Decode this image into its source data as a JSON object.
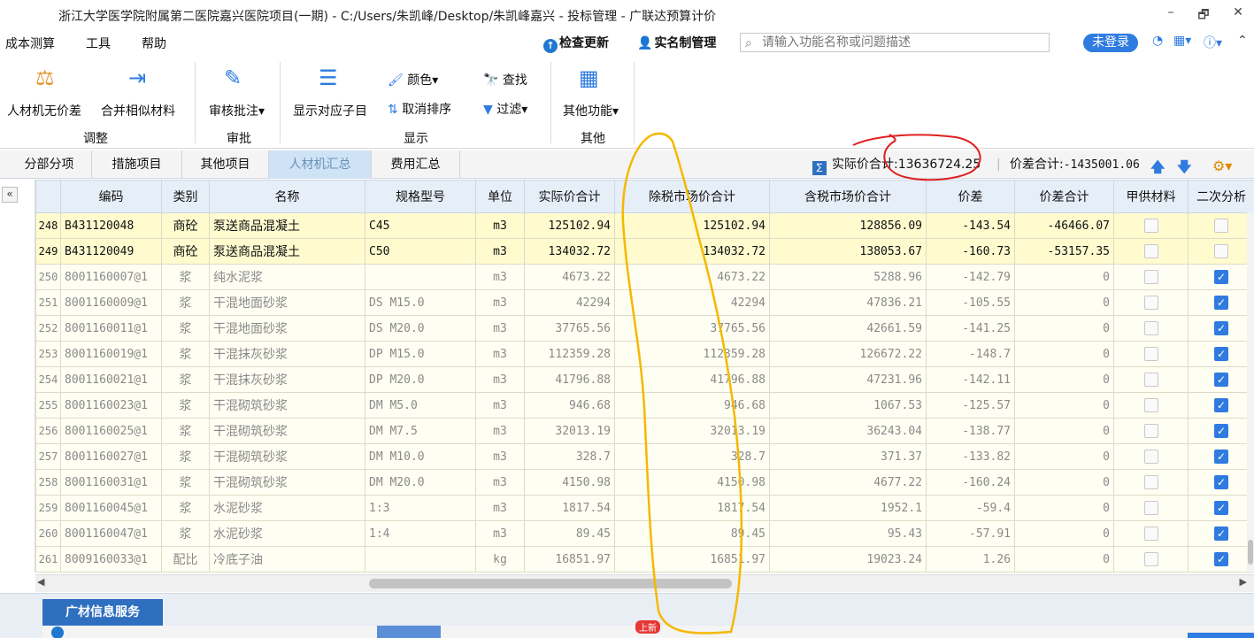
{
  "window": {
    "title": "浙江大学医学院附属第二医院嘉兴医院项目(一期) - C:/Users/朱凯峰/Desktop/朱凯峰嘉兴 - 投标管理 - 广联达预算计价",
    "min": "–",
    "max": "🗗",
    "close": "✕"
  },
  "menu": {
    "items": [
      "成本测算",
      "工具",
      "帮助"
    ],
    "check_update": "检查更新",
    "realname": "实名制管理",
    "search_placeholder": "请输入功能名称或问题描述",
    "login": "未登录"
  },
  "ribbon": {
    "btn_no_diff": "人材机无价差",
    "btn_merge": "合并相似材料",
    "btn_audit": "审核批注",
    "btn_show_sub": "显示对应子目",
    "btn_color": "颜色",
    "btn_cancel_sort": "取消排序",
    "btn_find": "查找",
    "btn_filter": "过滤",
    "btn_other": "其他功能",
    "grp_adjust": "调整",
    "grp_approve": "审批",
    "grp_display": "显示",
    "grp_other": "其他"
  },
  "tabs": [
    "分部分项",
    "措施项目",
    "其他项目",
    "人材机汇总",
    "费用汇总"
  ],
  "summary": {
    "actual_label": "实际价合计:",
    "actual_value": "13636724.25",
    "diff_label": "价差合计:",
    "diff_value": "-1435001.06"
  },
  "grid": {
    "headers": [
      "编码",
      "类别",
      "名称",
      "规格型号",
      "单位",
      "实际价合计",
      "除税市场价合计",
      "含税市场价合计",
      "价差",
      "价差合计",
      "甲供材料",
      "二次分析"
    ],
    "rows": [
      {
        "no": "248",
        "code": "B431120048",
        "type": "商砼",
        "name": "泵送商品混凝土",
        "spec": "C45",
        "unit": "m3",
        "actual": "125102.94",
        "ex_tax": "125102.94",
        "inc_tax": "128856.09",
        "diff": "-143.54",
        "diff_total": "-46466.07",
        "supplied": false,
        "secondary": false,
        "style": "hl"
      },
      {
        "no": "249",
        "code": "B431120049",
        "type": "商砼",
        "name": "泵送商品混凝土",
        "spec": "C50",
        "unit": "m3",
        "actual": "134032.72",
        "ex_tax": "134032.72",
        "inc_tax": "138053.67",
        "diff": "-160.73",
        "diff_total": "-53157.35",
        "supplied": false,
        "secondary": false,
        "style": "hl"
      },
      {
        "no": "250",
        "code": "8001160007@1",
        "type": "浆",
        "name": "纯水泥浆",
        "spec": "",
        "unit": "m3",
        "actual": "4673.22",
        "ex_tax": "4673.22",
        "inc_tax": "5288.96",
        "diff": "-142.79",
        "diff_total": "0",
        "supplied": false,
        "secondary": true,
        "style": "nm"
      },
      {
        "no": "251",
        "code": "8001160009@1",
        "type": "浆",
        "name": "干混地面砂浆",
        "spec": "DS M15.0",
        "unit": "m3",
        "actual": "42294",
        "ex_tax": "42294",
        "inc_tax": "47836.21",
        "diff": "-105.55",
        "diff_total": "0",
        "supplied": false,
        "secondary": true,
        "style": "nm"
      },
      {
        "no": "252",
        "code": "8001160011@1",
        "type": "浆",
        "name": "干混地面砂浆",
        "spec": "DS M20.0",
        "unit": "m3",
        "actual": "37765.56",
        "ex_tax": "37765.56",
        "inc_tax": "42661.59",
        "diff": "-141.25",
        "diff_total": "0",
        "supplied": false,
        "secondary": true,
        "style": "nm"
      },
      {
        "no": "253",
        "code": "8001160019@1",
        "type": "浆",
        "name": "干混抹灰砂浆",
        "spec": "DP M15.0",
        "unit": "m3",
        "actual": "112359.28",
        "ex_tax": "112359.28",
        "inc_tax": "126672.22",
        "diff": "-148.7",
        "diff_total": "0",
        "supplied": false,
        "secondary": true,
        "style": "nm"
      },
      {
        "no": "254",
        "code": "8001160021@1",
        "type": "浆",
        "name": "干混抹灰砂浆",
        "spec": "DP M20.0",
        "unit": "m3",
        "actual": "41796.88",
        "ex_tax": "41796.88",
        "inc_tax": "47231.96",
        "diff": "-142.11",
        "diff_total": "0",
        "supplied": false,
        "secondary": true,
        "style": "nm"
      },
      {
        "no": "255",
        "code": "8001160023@1",
        "type": "浆",
        "name": "干混砌筑砂浆",
        "spec": "DM M5.0",
        "unit": "m3",
        "actual": "946.68",
        "ex_tax": "946.68",
        "inc_tax": "1067.53",
        "diff": "-125.57",
        "diff_total": "0",
        "supplied": false,
        "secondary": true,
        "style": "nm"
      },
      {
        "no": "256",
        "code": "8001160025@1",
        "type": "浆",
        "name": "干混砌筑砂浆",
        "spec": "DM M7.5",
        "unit": "m3",
        "actual": "32013.19",
        "ex_tax": "32013.19",
        "inc_tax": "36243.04",
        "diff": "-138.77",
        "diff_total": "0",
        "supplied": false,
        "secondary": true,
        "style": "nm"
      },
      {
        "no": "257",
        "code": "8001160027@1",
        "type": "浆",
        "name": "干混砌筑砂浆",
        "spec": "DM M10.0",
        "unit": "m3",
        "actual": "328.7",
        "ex_tax": "328.7",
        "inc_tax": "371.37",
        "diff": "-133.82",
        "diff_total": "0",
        "supplied": false,
        "secondary": true,
        "style": "nm"
      },
      {
        "no": "258",
        "code": "8001160031@1",
        "type": "浆",
        "name": "干混砌筑砂浆",
        "spec": "DM M20.0",
        "unit": "m3",
        "actual": "4150.98",
        "ex_tax": "4150.98",
        "inc_tax": "4677.22",
        "diff": "-160.24",
        "diff_total": "0",
        "supplied": false,
        "secondary": true,
        "style": "nm"
      },
      {
        "no": "259",
        "code": "8001160045@1",
        "type": "浆",
        "name": "水泥砂浆",
        "spec": "1:3",
        "unit": "m3",
        "actual": "1817.54",
        "ex_tax": "1817.54",
        "inc_tax": "1952.1",
        "diff": "-59.4",
        "diff_total": "0",
        "supplied": false,
        "secondary": true,
        "style": "nm"
      },
      {
        "no": "260",
        "code": "8001160047@1",
        "type": "浆",
        "name": "水泥砂浆",
        "spec": "1:4",
        "unit": "m3",
        "actual": "89.45",
        "ex_tax": "89.45",
        "inc_tax": "95.43",
        "diff": "-57.91",
        "diff_total": "0",
        "supplied": false,
        "secondary": true,
        "style": "nm"
      },
      {
        "no": "261",
        "code": "8009160033@1",
        "type": "配比",
        "name": "冷底子油",
        "spec": "",
        "unit": "kg",
        "actual": "16851.97",
        "ex_tax": "16851.97",
        "inc_tax": "19023.24",
        "diff": "1.26",
        "diff_total": "0",
        "supplied": false,
        "secondary": true,
        "style": "nm"
      }
    ]
  },
  "bottom": {
    "tab": "广材信息服务",
    "new_badge": "上新"
  },
  "colors": {
    "accent": "#2f7be0",
    "highlight_row": "#fffbcf",
    "annotation_red": "#e02020",
    "annotation_orange": "#f5b800"
  }
}
